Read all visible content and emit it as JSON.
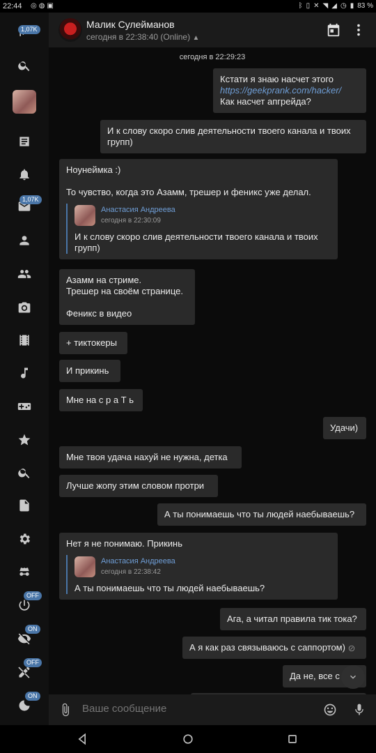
{
  "status_bar": {
    "time": "22:44",
    "battery": "83 %"
  },
  "sidebar": {
    "back_badge": "1,07K",
    "messages_badge": "1,07K",
    "toggle_badges": [
      "OFF",
      "ON",
      "OFF",
      "ON"
    ]
  },
  "header": {
    "name": "Малик Сулейманов",
    "status": "сегодня в 22:38:40 (Online)"
  },
  "chat": {
    "date_separator": "сегодня в 22:29:23",
    "messages": [
      {
        "dir": "out",
        "text_before": "Кстати я знаю насчет этого",
        "link": "https://geekprank.com/hacker/",
        "text_after": "Как насчет апгрейда?"
      },
      {
        "dir": "out",
        "text": "И к слову скоро слив деятельности твоего канала и твоих групп)"
      },
      {
        "dir": "in",
        "text": "Ноунеймка :)\n\nТо чувство, когда это Азамм, трешер и феникс уже делал.",
        "fwd_name": "Анастасия Андреева",
        "fwd_time": "сегодня в 22:30:09",
        "fwd_text": "И к слову скоро слив деятельности твоего канала и твоих групп)"
      },
      {
        "dir": "in",
        "text": "Азамм на стриме.\nТрешер на своём странице.\n\nФеникс в видео"
      },
      {
        "dir": "in",
        "text": "+ тиктокеры"
      },
      {
        "dir": "in",
        "text": "И прикинь"
      },
      {
        "dir": "in",
        "text": "Мне на с р а Т ь"
      },
      {
        "dir": "out",
        "text": "Удачи)"
      },
      {
        "dir": "in",
        "text": "Мне твоя удача нахуй не нужна, детка"
      },
      {
        "dir": "in",
        "text": "Лучше жопу этим словом протри"
      },
      {
        "dir": "out",
        "text": "А ты понимаешь что ты людей наебываешь?"
      },
      {
        "dir": "in",
        "text": "Нет я не понимаю. Прикинь",
        "fwd_name": "Анастасия Андреева",
        "fwd_time": "сегодня в 22:38:42",
        "fwd_text": "А ты понимаешь что ты людей наебываешь?"
      },
      {
        "dir": "out",
        "text": "Ага, а читал правила тик тока?"
      },
      {
        "dir": "out",
        "text": "А я как раз связываюсь с саппортом)"
      },
      {
        "dir": "out",
        "text": "Да не, все с"
      }
    ]
  },
  "input": {
    "placeholder": "Ваше сообщение"
  }
}
